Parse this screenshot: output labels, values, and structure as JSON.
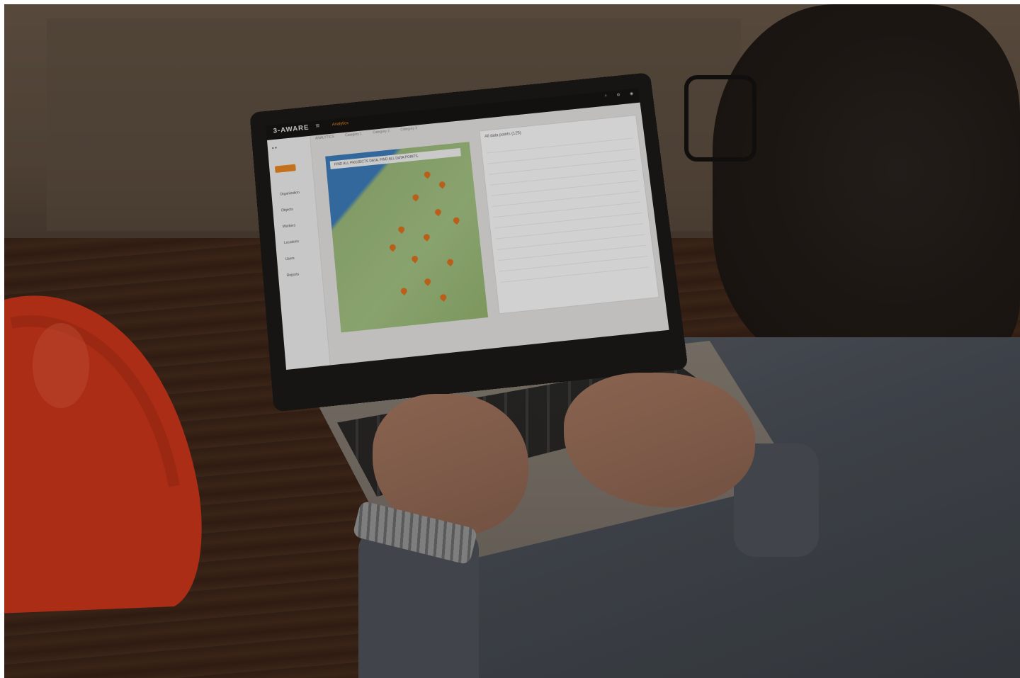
{
  "screen": {
    "brand": "3-AWARE",
    "menu_icon": "menu-icon",
    "active_nav": "Analytics",
    "subtabs": [
      "ANALYTICS",
      "Category 1",
      "Category 2",
      "Category 3"
    ],
    "map_note": "FIND ALL PROJECTS DATA. FIND ALL DATA POINTS.",
    "panel_title": "All data points (125)",
    "sidebar_items": [
      "Organization",
      "Objects",
      "Workers",
      "Locations",
      "Users",
      "Reports"
    ]
  },
  "colors": {
    "accent": "#f08a24",
    "helmet": "#d2381c",
    "topbar": "#161514"
  }
}
